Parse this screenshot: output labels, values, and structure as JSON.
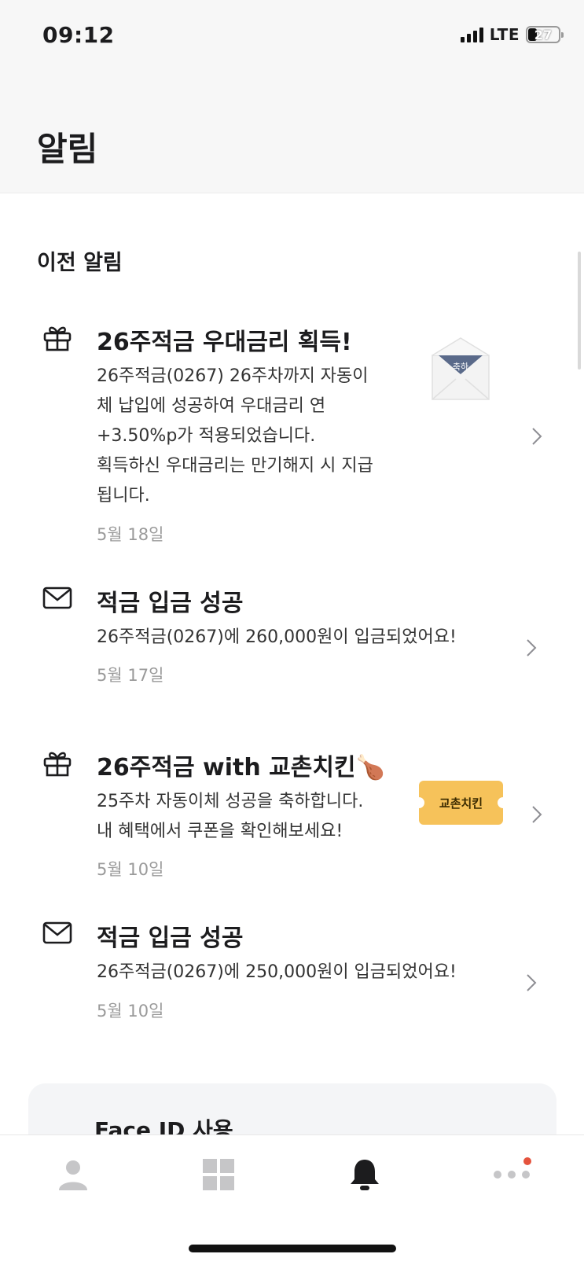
{
  "status_bar": {
    "time": "09:12",
    "network": "LTE",
    "battery": "27",
    "battery_level_percent": 27
  },
  "header": {
    "title": "알림"
  },
  "section": {
    "title": "이전 알림"
  },
  "notifications": [
    {
      "icon": "gift-icon",
      "title": "26주적금 우대금리 획득!",
      "body_lines": [
        "26주적금(0267) 26주차까지 자동이",
        "체 납입에 성공하여 우대금리 연",
        "+3.50%p가 적용되었습니다.",
        "획득하신 우대금리는 만기해지 시 지급",
        "됩니다."
      ],
      "date": "5월 18일",
      "thumbnail": "envelope",
      "thumbnail_text": "축하"
    },
    {
      "icon": "mail-icon",
      "title": "적금 입금 성공",
      "body_lines": [
        "26주적금(0267)에 260,000원이 입금되었어요!"
      ],
      "date": "5월 17일"
    },
    {
      "icon": "gift-icon",
      "title": "26주적금 with 교촌치킨🍗",
      "body_lines": [
        "25주차 자동이체 성공을 축하합니다.",
        "내 혜택에서 쿠폰을 확인해보세요!"
      ],
      "date": "5월 10일",
      "thumbnail": "coupon",
      "thumbnail_text": "교촌치킨"
    },
    {
      "icon": "mail-icon",
      "title": "적금 입금 성공",
      "body_lines": [
        "26주적금(0267)에 250,000원이 입금되었어요!"
      ],
      "date": "5월 10일"
    }
  ],
  "faceid_card": {
    "title": "Face ID 사용"
  },
  "tabbar": {
    "items": [
      {
        "icon": "person-icon",
        "active": false
      },
      {
        "icon": "grid-icon",
        "active": false
      },
      {
        "icon": "bell-icon",
        "active": true
      },
      {
        "icon": "more-icon",
        "active": false,
        "badge": true
      }
    ]
  },
  "colors": {
    "active_tab": "#1c1c1e",
    "inactive_tab": "#c6c6c8",
    "badge": "#e5533d",
    "coupon": "#f6c25a",
    "date_text": "#9a9a9a"
  }
}
